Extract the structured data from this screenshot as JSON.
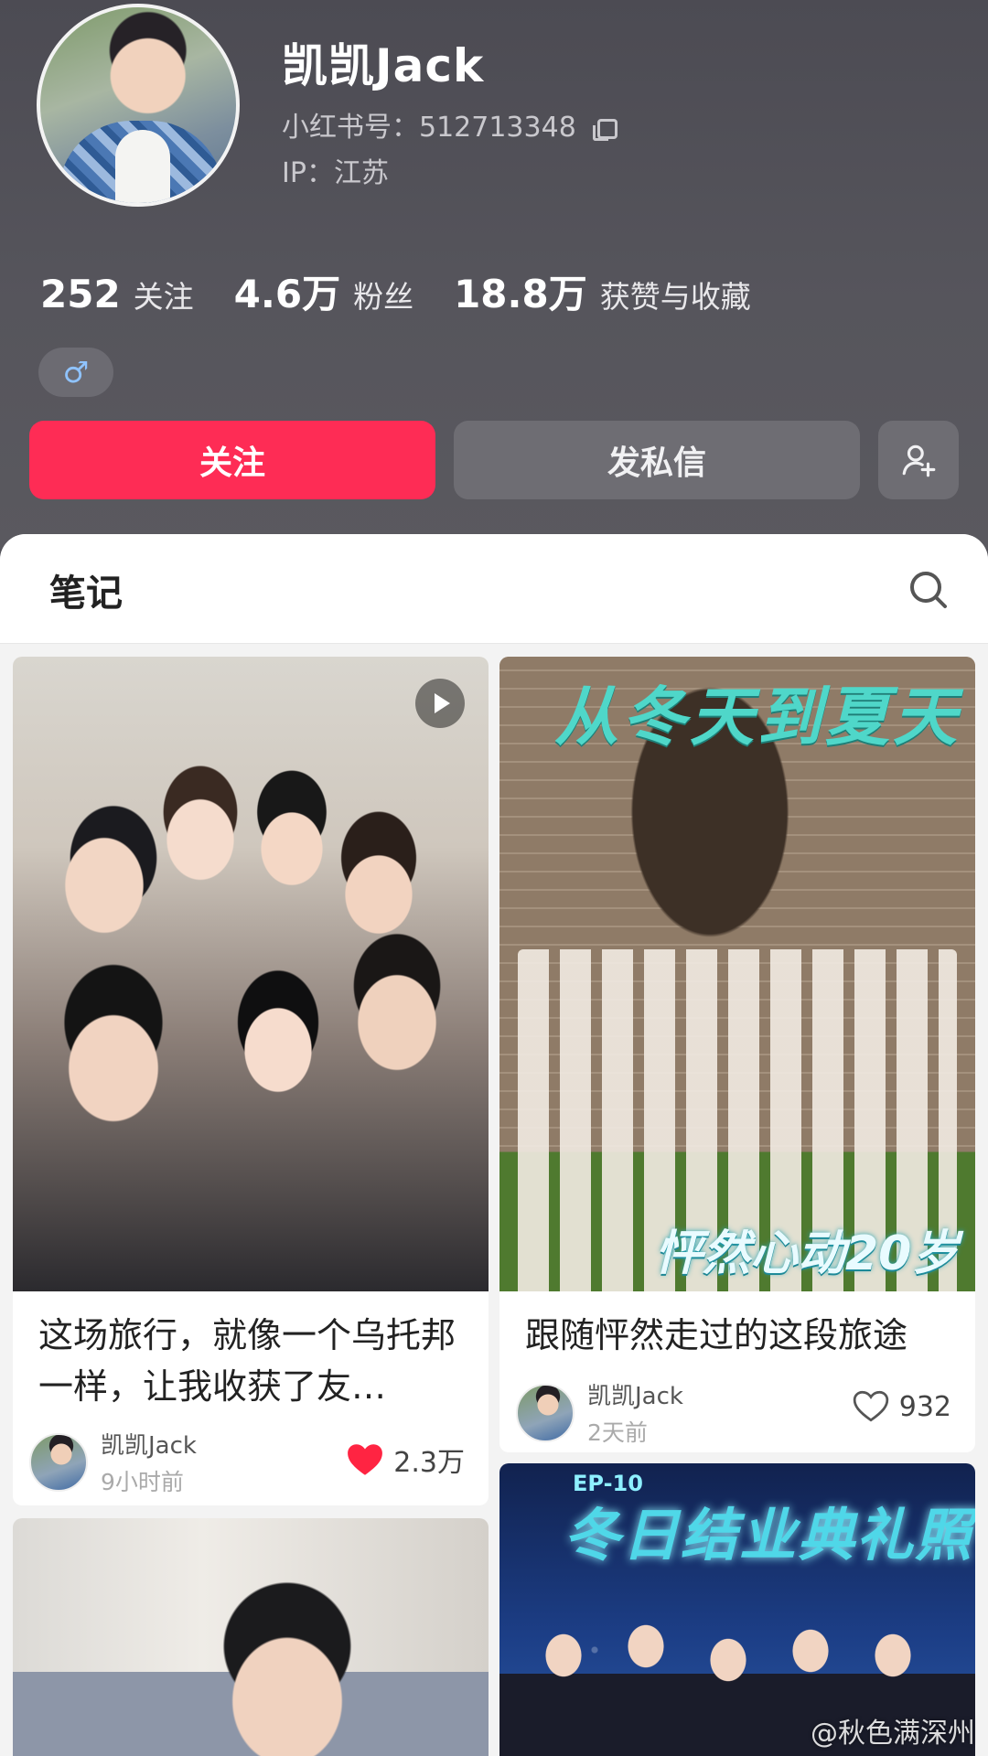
{
  "profile": {
    "name": "凯凯Jack",
    "id_line": "小红书号：512713348",
    "ip_line": "IP：江苏",
    "gender_icon": "male-icon",
    "gender_symbol": "♂"
  },
  "stats": [
    {
      "value": "252",
      "label": "关注"
    },
    {
      "value": "4.6万",
      "label": "粉丝"
    },
    {
      "value": "18.8万",
      "label": "获赞与收藏"
    }
  ],
  "actions": {
    "follow": "关注",
    "message": "发私信",
    "add_friend_icon": "add-user-icon"
  },
  "colors": {
    "follow_red": "#fe2c55",
    "header_bg": "#54535a",
    "like_red": "#ff2442",
    "teal_title": "#4fd7c9"
  },
  "notes": {
    "tab_label": "笔记",
    "search_icon": "search-icon",
    "cards": [
      {
        "title": "这场旅行，就像一个乌托邦一样，让我收获了友…",
        "author": "凯凯Jack",
        "time": "9小时前",
        "likes": "2.3万",
        "liked": true,
        "is_video": true
      },
      {
        "title": "跟随怦然走过的这段旅途",
        "author": "凯凯Jack",
        "time": "2天前",
        "likes": "932",
        "liked": false,
        "image_text": "从冬天到夏天",
        "image_logo": "怦然心动20岁"
      },
      {
        "image_text": "冬日结业典礼照",
        "image_subtext": "EP-10"
      },
      {}
    ]
  },
  "watermark": "@秋色满深州"
}
